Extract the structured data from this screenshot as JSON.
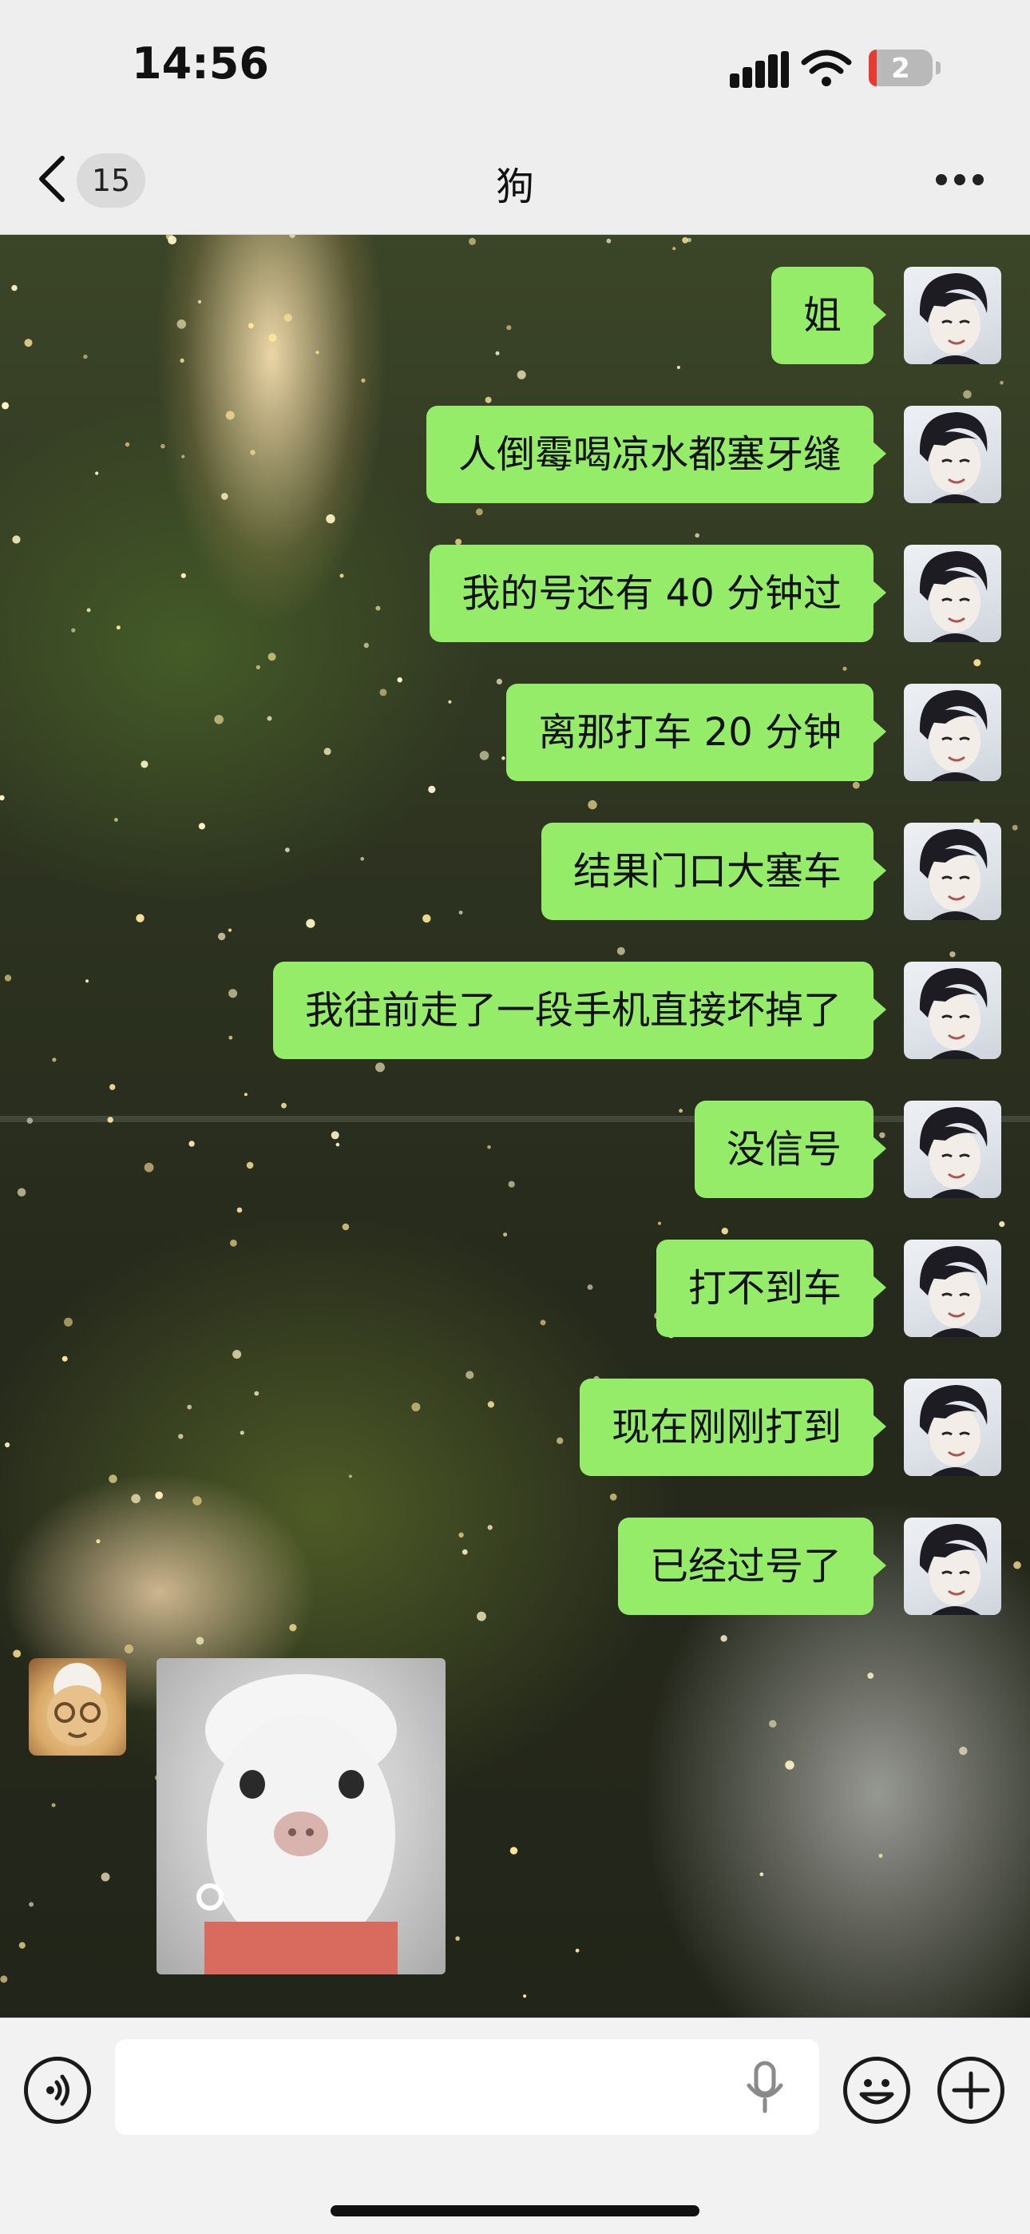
{
  "status_bar": {
    "time": "14:56",
    "battery_label": "2",
    "battery_level": 0.12,
    "signal_icon": "cellular-signal-icon",
    "wifi_icon": "wifi-icon"
  },
  "header": {
    "back_icon": "chevron-left-icon",
    "unread_count": "15",
    "title": "狗",
    "more_icon": "more-horizontal-icon"
  },
  "messages": [
    {
      "sender": "me",
      "text": "姐"
    },
    {
      "sender": "me",
      "text": "人倒霉喝凉水都塞牙缝"
    },
    {
      "sender": "me",
      "text": "我的号还有 40 分钟过"
    },
    {
      "sender": "me",
      "text": "离那打车 20 分钟"
    },
    {
      "sender": "me",
      "text": "结果门口大塞车"
    },
    {
      "sender": "me",
      "text": "我往前走了一段手机直接坏掉了"
    },
    {
      "sender": "me",
      "text": "没信号"
    },
    {
      "sender": "me",
      "text": "打不到车"
    },
    {
      "sender": "me",
      "text": "现在刚刚打到"
    },
    {
      "sender": "me",
      "text": "已经过号了"
    },
    {
      "sender": "them",
      "type": "sticker",
      "text": ""
    }
  ],
  "input_bar": {
    "value": "",
    "voice_icon": "voice-mode-icon",
    "mic_icon": "microphone-icon",
    "emoji_icon": "emoji-icon",
    "plus_icon": "plus-icon"
  },
  "colors": {
    "bubble_mine": "#95ec69",
    "header_bg": "#eeeeee",
    "inputbar_bg": "#f2f2f2"
  }
}
